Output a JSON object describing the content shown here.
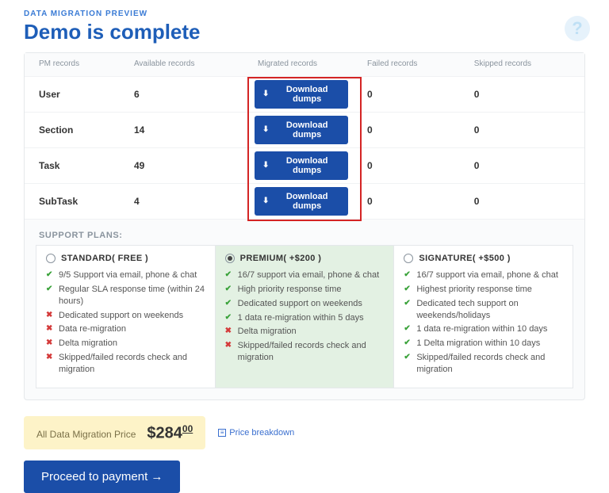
{
  "header": {
    "eyebrow": "DATA MIGRATION PREVIEW",
    "title": "Demo is complete"
  },
  "table": {
    "columns": {
      "records": "PM records",
      "available": "Available records",
      "migrated": "Migrated records",
      "failed": "Failed records",
      "skipped": "Skipped records"
    },
    "download_label": "Download dumps",
    "rows": [
      {
        "name": "User",
        "available": "6",
        "failed": "0",
        "skipped": "0"
      },
      {
        "name": "Section",
        "available": "14",
        "failed": "0",
        "skipped": "0"
      },
      {
        "name": "Task",
        "available": "49",
        "failed": "0",
        "skipped": "0"
      },
      {
        "name": "SubTask",
        "available": "4",
        "failed": "0",
        "skipped": "0"
      }
    ]
  },
  "plans": {
    "title": "SUPPORT PLANS:",
    "items": [
      {
        "name": "STANDARD( FREE )",
        "selected": false,
        "features": [
          {
            "ok": true,
            "text": "9/5 Support via email, phone & chat"
          },
          {
            "ok": true,
            "text": "Regular SLA response time (within 24 hours)"
          },
          {
            "ok": false,
            "text": "Dedicated support on weekends"
          },
          {
            "ok": false,
            "text": "Data re-migration"
          },
          {
            "ok": false,
            "text": "Delta migration"
          },
          {
            "ok": false,
            "text": "Skipped/failed records check and migration"
          }
        ]
      },
      {
        "name": "PREMIUM( +$200 )",
        "selected": true,
        "features": [
          {
            "ok": true,
            "text": "16/7 support via email, phone & chat"
          },
          {
            "ok": true,
            "text": "High priority response time"
          },
          {
            "ok": true,
            "text": "Dedicated support on weekends"
          },
          {
            "ok": true,
            "text": "1 data re-migration within 5 days"
          },
          {
            "ok": false,
            "text": "Delta migration"
          },
          {
            "ok": false,
            "text": "Skipped/failed records check and migration"
          }
        ]
      },
      {
        "name": "SIGNATURE( +$500 )",
        "selected": false,
        "features": [
          {
            "ok": true,
            "text": "16/7 support via email, phone & chat"
          },
          {
            "ok": true,
            "text": "Highest priority response time"
          },
          {
            "ok": true,
            "text": "Dedicated tech support on weekends/holidays"
          },
          {
            "ok": true,
            "text": "1 data re-migration within 10 days"
          },
          {
            "ok": true,
            "text": "1 Delta migration within 10 days"
          },
          {
            "ok": true,
            "text": "Skipped/failed records check and migration"
          }
        ]
      }
    ]
  },
  "price": {
    "label": "All Data Migration Price",
    "whole": "$284",
    "cents": "00",
    "breakdown": "Price breakdown"
  },
  "buttons": {
    "proceed": "Proceed to payment →"
  }
}
